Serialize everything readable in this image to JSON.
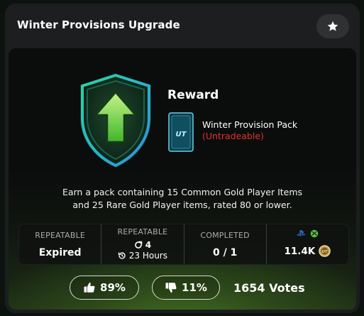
{
  "header": {
    "title": "Winter Provisions Upgrade",
    "favorite_icon": "star-icon"
  },
  "reward": {
    "label": "Reward",
    "pack_name": "Winter Provision Pack",
    "tradeability": "(Untradeable)",
    "pack_logo_text": "UT"
  },
  "description": {
    "line1": "Earn a pack containing 15 Common Gold Player Items",
    "line2": "and 25 Rare Gold Player items, rated 80 or lower."
  },
  "stats": {
    "repeatable_1": {
      "label": "REPEATABLE",
      "value": "Expired"
    },
    "repeatable_2": {
      "label": "REPEATABLE",
      "count": "4",
      "time": "23 Hours"
    },
    "completed": {
      "label": "COMPLETED",
      "value": "0 / 1"
    },
    "price": {
      "value": "11.4K",
      "platforms": [
        "playstation-icon",
        "xbox-icon"
      ],
      "coin_icon": "ut-coin-icon"
    }
  },
  "votes": {
    "up_percent": "89%",
    "down_percent": "11%",
    "total": "1654 Votes"
  },
  "colors": {
    "accent_red": "#e0352b",
    "badge_green": "#7fd64a",
    "playstation_blue": "#2f6fd6",
    "xbox_green": "#58c23a"
  }
}
